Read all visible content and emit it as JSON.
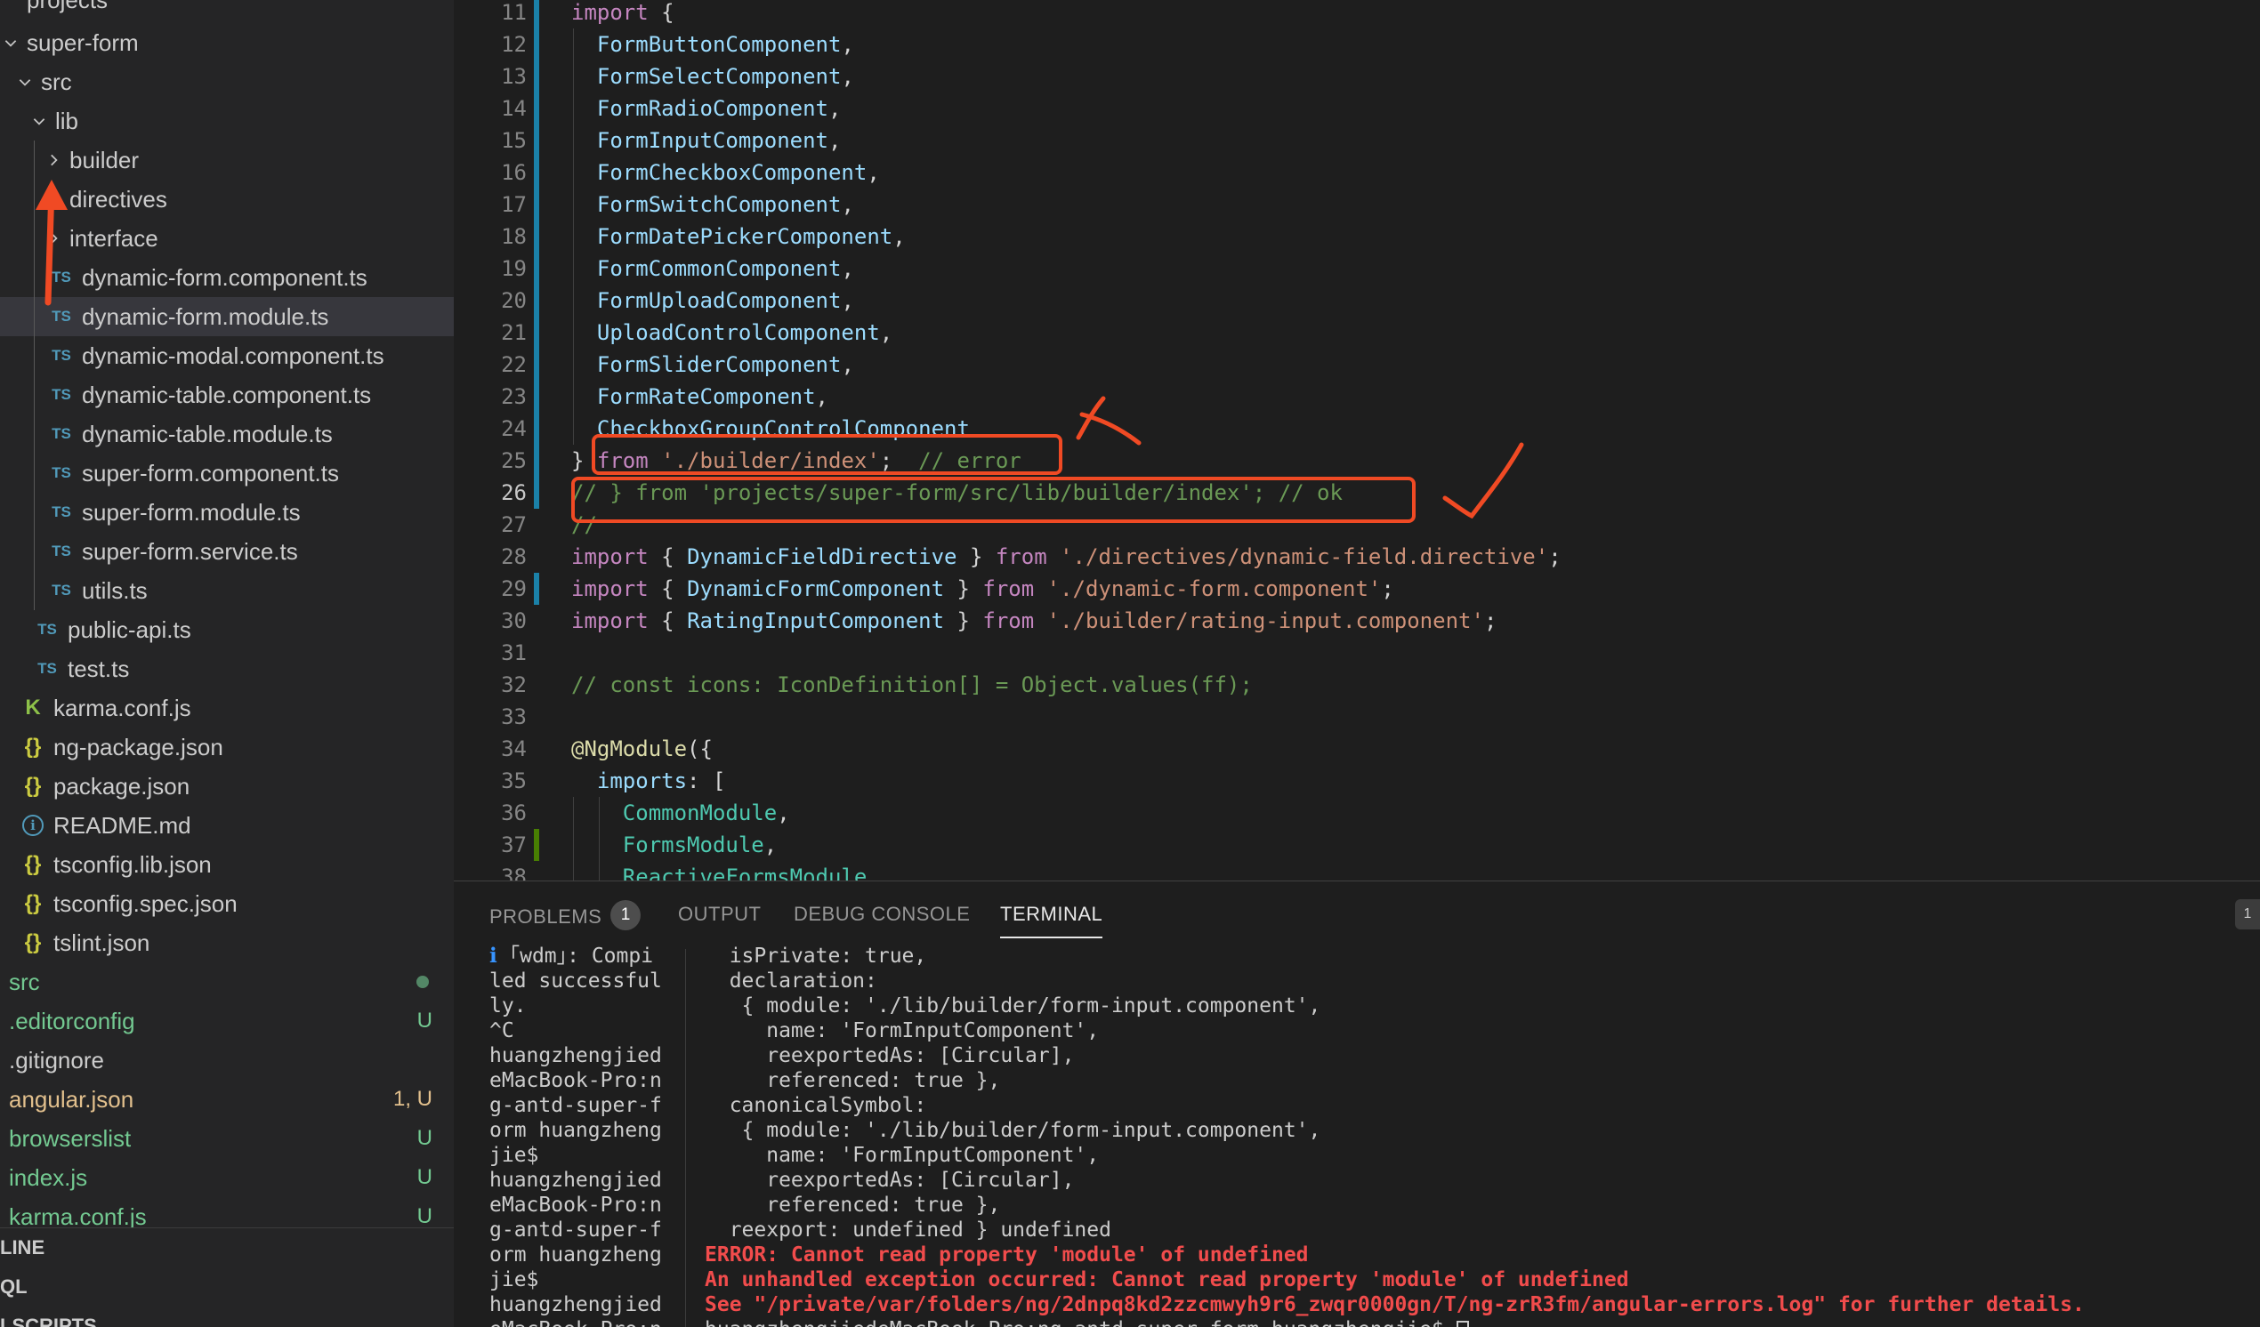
{
  "sidebar": {
    "header_partial": "projects",
    "tree": [
      {
        "label": "super-form",
        "kind": "folder-open",
        "depth": 0
      },
      {
        "label": "src",
        "kind": "folder-open",
        "depth": 1
      },
      {
        "label": "lib",
        "kind": "folder-open",
        "depth": 2
      },
      {
        "label": "builder",
        "kind": "folder-closed",
        "depth": 3
      },
      {
        "label": "directives",
        "kind": "folder-closed",
        "depth": 3
      },
      {
        "label": "interface",
        "kind": "folder-closed",
        "depth": 3
      },
      {
        "label": "dynamic-form.component.ts",
        "kind": "ts",
        "depth": 3
      },
      {
        "label": "dynamic-form.module.ts",
        "kind": "ts",
        "depth": 3,
        "selected": true
      },
      {
        "label": "dynamic-modal.component.ts",
        "kind": "ts",
        "depth": 3
      },
      {
        "label": "dynamic-table.component.ts",
        "kind": "ts",
        "depth": 3
      },
      {
        "label": "dynamic-table.module.ts",
        "kind": "ts",
        "depth": 3
      },
      {
        "label": "super-form.component.ts",
        "kind": "ts",
        "depth": 3
      },
      {
        "label": "super-form.module.ts",
        "kind": "ts",
        "depth": 3
      },
      {
        "label": "super-form.service.ts",
        "kind": "ts",
        "depth": 3
      },
      {
        "label": "utils.ts",
        "kind": "ts",
        "depth": 3
      },
      {
        "label": "public-api.ts",
        "kind": "ts",
        "depth": 2
      },
      {
        "label": "test.ts",
        "kind": "ts",
        "depth": 2
      },
      {
        "label": "karma.conf.js",
        "kind": "karma",
        "depth": 1
      },
      {
        "label": "ng-package.json",
        "kind": "json",
        "depth": 1
      },
      {
        "label": "package.json",
        "kind": "json",
        "depth": 1
      },
      {
        "label": "README.md",
        "kind": "info",
        "depth": 1
      },
      {
        "label": "tsconfig.lib.json",
        "kind": "json",
        "depth": 1
      },
      {
        "label": "tsconfig.spec.json",
        "kind": "json",
        "depth": 1
      },
      {
        "label": "tslint.json",
        "kind": "json",
        "depth": 1
      },
      {
        "label": "src",
        "kind": "plain-green",
        "depth": 0,
        "status": "dot"
      },
      {
        "label": ".editorconfig",
        "kind": "plain-green",
        "depth": 0,
        "status": "U"
      },
      {
        "label": ".gitignore",
        "kind": "plain",
        "depth": 0
      },
      {
        "label": "angular.json",
        "kind": "plain-yellow",
        "depth": 0,
        "status": "1, U"
      },
      {
        "label": "browserslist",
        "kind": "plain-green",
        "depth": 0,
        "status": "U"
      },
      {
        "label": "index.js",
        "kind": "plain-green",
        "depth": 0,
        "status": "U"
      },
      {
        "label": "karma.conf.js",
        "kind": "plain-green",
        "depth": 0,
        "status": "U"
      }
    ],
    "ts_badge": "TS",
    "json_badge": "{}",
    "karma_badge": "K",
    "info_badge": "i",
    "bottom_panels": [
      "LINE",
      "QL",
      "LSCRIPTS"
    ]
  },
  "editor": {
    "lines": [
      {
        "n": "11",
        "tokens": [
          [
            "kw",
            "import"
          ],
          [
            "punc",
            " {"
          ]
        ]
      },
      {
        "n": "12",
        "tokens": [
          [
            "id",
            "  FormButtonComponent"
          ],
          [
            "punc",
            ","
          ]
        ]
      },
      {
        "n": "13",
        "tokens": [
          [
            "id",
            "  FormSelectComponent"
          ],
          [
            "punc",
            ","
          ]
        ]
      },
      {
        "n": "14",
        "tokens": [
          [
            "id",
            "  FormRadioComponent"
          ],
          [
            "punc",
            ","
          ]
        ]
      },
      {
        "n": "15",
        "tokens": [
          [
            "id",
            "  FormInputComponent"
          ],
          [
            "punc",
            ","
          ]
        ]
      },
      {
        "n": "16",
        "tokens": [
          [
            "id",
            "  FormCheckboxComponent"
          ],
          [
            "punc",
            ","
          ]
        ]
      },
      {
        "n": "17",
        "tokens": [
          [
            "id",
            "  FormSwitchComponent"
          ],
          [
            "punc",
            ","
          ]
        ]
      },
      {
        "n": "18",
        "tokens": [
          [
            "id",
            "  FormDatePickerComponent"
          ],
          [
            "punc",
            ","
          ]
        ]
      },
      {
        "n": "19",
        "tokens": [
          [
            "id",
            "  FormCommonComponent"
          ],
          [
            "punc",
            ","
          ]
        ]
      },
      {
        "n": "20",
        "tokens": [
          [
            "id",
            "  FormUploadComponent"
          ],
          [
            "punc",
            ","
          ]
        ]
      },
      {
        "n": "21",
        "tokens": [
          [
            "id",
            "  UploadControlComponent"
          ],
          [
            "punc",
            ","
          ]
        ]
      },
      {
        "n": "22",
        "tokens": [
          [
            "id",
            "  FormSliderComponent"
          ],
          [
            "punc",
            ","
          ]
        ]
      },
      {
        "n": "23",
        "tokens": [
          [
            "id",
            "  FormRateComponent"
          ],
          [
            "punc",
            ","
          ]
        ]
      },
      {
        "n": "24",
        "tokens": [
          [
            "id",
            "  CheckboxGroupControlComponent"
          ]
        ]
      },
      {
        "n": "25",
        "tokens": [
          [
            "punc",
            "} "
          ],
          [
            "kw",
            "from"
          ],
          [
            "punc",
            " "
          ],
          [
            "str",
            "'./builder/index'"
          ],
          [
            "punc",
            ";  "
          ],
          [
            "cmt",
            "// error"
          ]
        ]
      },
      {
        "n": "26",
        "tokens": [
          [
            "cmt",
            "// } from 'projects/super-form/src/lib/builder/index'; // ok"
          ]
        ],
        "active": true
      },
      {
        "n": "27",
        "tokens": [
          [
            "cmt",
            "//"
          ]
        ]
      },
      {
        "n": "28",
        "tokens": [
          [
            "kw",
            "import"
          ],
          [
            "punc",
            " { "
          ],
          [
            "id",
            "DynamicFieldDirective"
          ],
          [
            "punc",
            " } "
          ],
          [
            "kw",
            "from"
          ],
          [
            "punc",
            " "
          ],
          [
            "str",
            "'./directives/dynamic-field.directive'"
          ],
          [
            "punc",
            ";"
          ]
        ]
      },
      {
        "n": "29",
        "tokens": [
          [
            "kw",
            "import"
          ],
          [
            "punc",
            " { "
          ],
          [
            "id",
            "DynamicFormComponent"
          ],
          [
            "punc",
            " } "
          ],
          [
            "kw",
            "from"
          ],
          [
            "punc",
            " "
          ],
          [
            "str",
            "'./dynamic-form.component'"
          ],
          [
            "punc",
            ";"
          ]
        ]
      },
      {
        "n": "30",
        "tokens": [
          [
            "kw",
            "import"
          ],
          [
            "punc",
            " { "
          ],
          [
            "id",
            "RatingInputComponent"
          ],
          [
            "punc",
            " } "
          ],
          [
            "kw",
            "from"
          ],
          [
            "punc",
            " "
          ],
          [
            "str",
            "'./builder/rating-input.component'"
          ],
          [
            "punc",
            ";"
          ]
        ]
      },
      {
        "n": "31",
        "tokens": []
      },
      {
        "n": "32",
        "tokens": [
          [
            "cmt",
            "// const icons: IconDefinition[] = Object.values(ff);"
          ]
        ]
      },
      {
        "n": "33",
        "tokens": []
      },
      {
        "n": "34",
        "tokens": [
          [
            "fn",
            "@NgModule"
          ],
          [
            "punc",
            "({"
          ]
        ]
      },
      {
        "n": "35",
        "tokens": [
          [
            "id",
            "  imports"
          ],
          [
            "punc",
            ": ["
          ]
        ]
      },
      {
        "n": "36",
        "tokens": [
          [
            "cls",
            "    CommonModule"
          ],
          [
            "punc",
            ","
          ]
        ]
      },
      {
        "n": "37",
        "tokens": [
          [
            "cls",
            "    FormsModule"
          ],
          [
            "punc",
            ","
          ]
        ]
      },
      {
        "n": "38",
        "tokens": [
          [
            "cls",
            "    ReactiveFormsModule"
          ]
        ]
      }
    ]
  },
  "panel": {
    "tabs": [
      {
        "label": "PROBLEMS",
        "badge": "1"
      },
      {
        "label": "OUTPUT"
      },
      {
        "label": "DEBUG CONSOLE"
      },
      {
        "label": "TERMINAL",
        "active": true
      }
    ],
    "collapse_glyph": "1",
    "terminal_left": [
      {
        "cls": "info",
        "text": "ℹ"
      },
      {
        "cls": "",
        "text": " ｢wdm｣: Compi"
      },
      {
        "cls": "",
        "text": "led successful"
      },
      {
        "cls": "",
        "text": "ly."
      },
      {
        "cls": "",
        "text": "^C"
      },
      {
        "cls": "",
        "text": "huangzhengjied"
      },
      {
        "cls": "",
        "text": "eMacBook-Pro:n"
      },
      {
        "cls": "",
        "text": "g-antd-super-f"
      },
      {
        "cls": "",
        "text": "orm huangzheng"
      },
      {
        "cls": "",
        "text": "jie$"
      },
      {
        "cls": "",
        "text": "huangzhengjied"
      },
      {
        "cls": "",
        "text": "eMacBook-Pro:n"
      },
      {
        "cls": "",
        "text": "g-antd-super-f"
      },
      {
        "cls": "",
        "text": "orm huangzheng"
      },
      {
        "cls": "",
        "text": "jie$"
      },
      {
        "cls": "",
        "text": "huangzhengjied"
      },
      {
        "cls": "",
        "text": "eMacBook-Pro:n"
      }
    ],
    "terminal_right": [
      {
        "cls": "",
        "text": "  isPrivate: true,"
      },
      {
        "cls": "",
        "text": "  declaration:"
      },
      {
        "cls": "",
        "text": "   { module: './lib/builder/form-input.component',"
      },
      {
        "cls": "",
        "text": "     name: 'FormInputComponent',"
      },
      {
        "cls": "",
        "text": "     reexportedAs: [Circular],"
      },
      {
        "cls": "",
        "text": "     referenced: true },"
      },
      {
        "cls": "",
        "text": "  canonicalSymbol:"
      },
      {
        "cls": "",
        "text": "   { module: './lib/builder/form-input.component',"
      },
      {
        "cls": "",
        "text": "     name: 'FormInputComponent',"
      },
      {
        "cls": "",
        "text": "     reexportedAs: [Circular],"
      },
      {
        "cls": "",
        "text": "     referenced: true },"
      },
      {
        "cls": "",
        "text": "  reexport: undefined } undefined"
      },
      {
        "cls": "err",
        "text": "ERROR: Cannot read property 'module' of undefined"
      },
      {
        "cls": "err",
        "text": "An unhandled exception occurred: Cannot read property 'module' of undefined"
      },
      {
        "cls": "err",
        "text": "See \"/private/var/folders/ng/2dnpq8kd2zzcmwyh9r6_zwqr0000gn/T/ng-zrR3fm/angular-errors.log\" for further details."
      },
      {
        "cls": "",
        "text": "huangzhengjiedeMacBook-Pro:ng-antd-super-form huangzhengjie$ "
      }
    ]
  },
  "annotation_colors": {
    "stroke": "#f04a24"
  }
}
